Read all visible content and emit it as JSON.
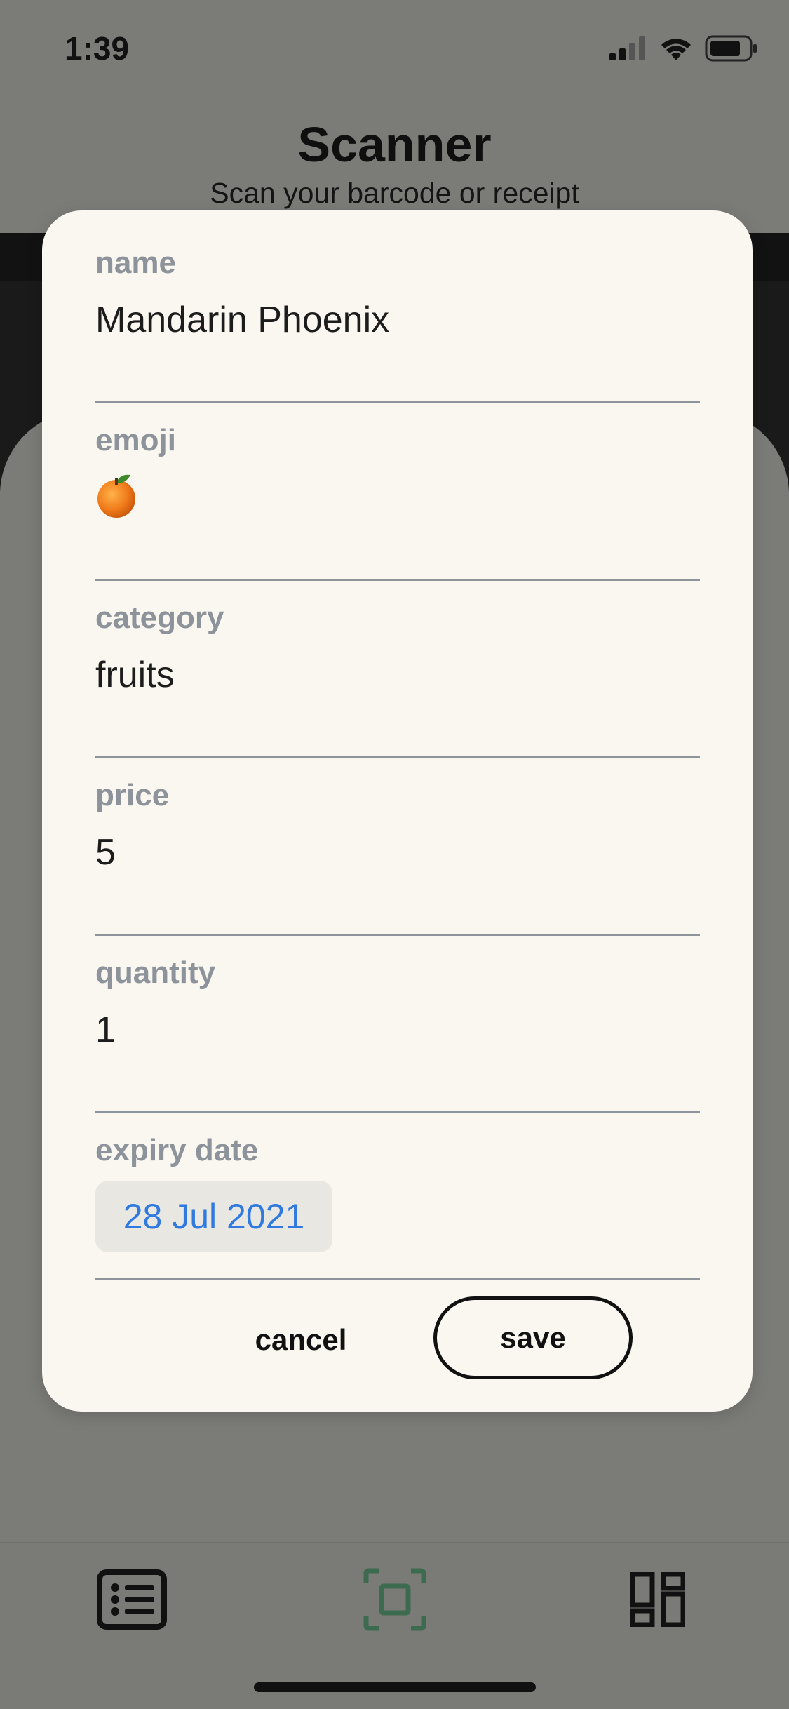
{
  "status_bar": {
    "time": "1:39"
  },
  "header": {
    "title": "Scanner",
    "subtitle": "Scan your barcode or receipt"
  },
  "form": {
    "fields": [
      {
        "label": "name",
        "value": "Mandarin Phoenix"
      },
      {
        "label": "emoji",
        "value": "🍊"
      },
      {
        "label": "category",
        "value": "fruits"
      },
      {
        "label": "price",
        "value": "5"
      },
      {
        "label": "quantity",
        "value": "1"
      },
      {
        "label": "expiry date",
        "value": "28 Jul 2021"
      }
    ],
    "cancel_label": "cancel",
    "save_label": "save"
  },
  "tab_bar": {
    "tabs": [
      {
        "icon": "list-icon",
        "active": false
      },
      {
        "icon": "scan-icon",
        "active": true
      },
      {
        "icon": "dashboard-icon",
        "active": false
      }
    ],
    "active_color": "#3d6b4f"
  },
  "colors": {
    "modal_bg": "#f9f7ef",
    "label": "#8d939a",
    "date_accent": "#2f79e0",
    "overlay": "#7b7b78"
  }
}
